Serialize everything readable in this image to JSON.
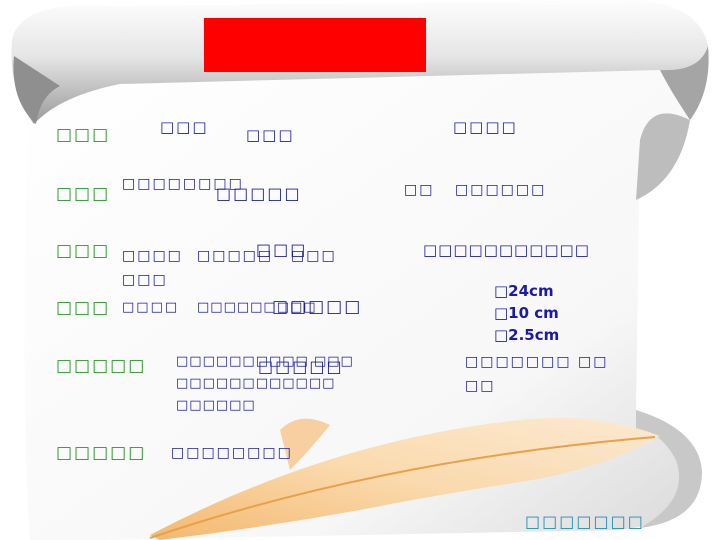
{
  "rows": {
    "r1": {
      "label": "□□□",
      "a": "□□□",
      "b": "□□□",
      "c": "□□□□"
    },
    "r2": {
      "label": "□□□",
      "a": "□□□□□□□□",
      "b": "□□□□□",
      "c": "□□",
      "d": "□□□□□□"
    },
    "r3": {
      "label": "□□□",
      "a": "□□□□",
      "b": "□□□□□",
      "c": "□□□",
      "d": "□□□",
      "e": "□□□",
      "f": "□□□□□□□□□□□"
    },
    "r4": {
      "label": "□□□",
      "a": "□□□□",
      "b": "□□□□□□□□□",
      "c": "□□□□□",
      "m1": "□24cm",
      "m2": "□10 cm",
      "m3": "□2.5cm"
    },
    "r5": {
      "label": "□□□□□",
      "a1": "□□□□□□□□□□ □□□",
      "a2": "□□□□□□□□□□□□",
      "a3": "□□□□□□",
      "b": "□□□□□",
      "c1": "□□□□□□□ □□",
      "c2": "□□"
    },
    "r6": {
      "label": "□□□□□",
      "a": "□□□□□□□□"
    }
  },
  "footer": {
    "text": "□□□□□□□"
  },
  "colors": {
    "title_box": "#ff0000",
    "green_text": "#229922",
    "blue_text": "#1a1aa8"
  }
}
